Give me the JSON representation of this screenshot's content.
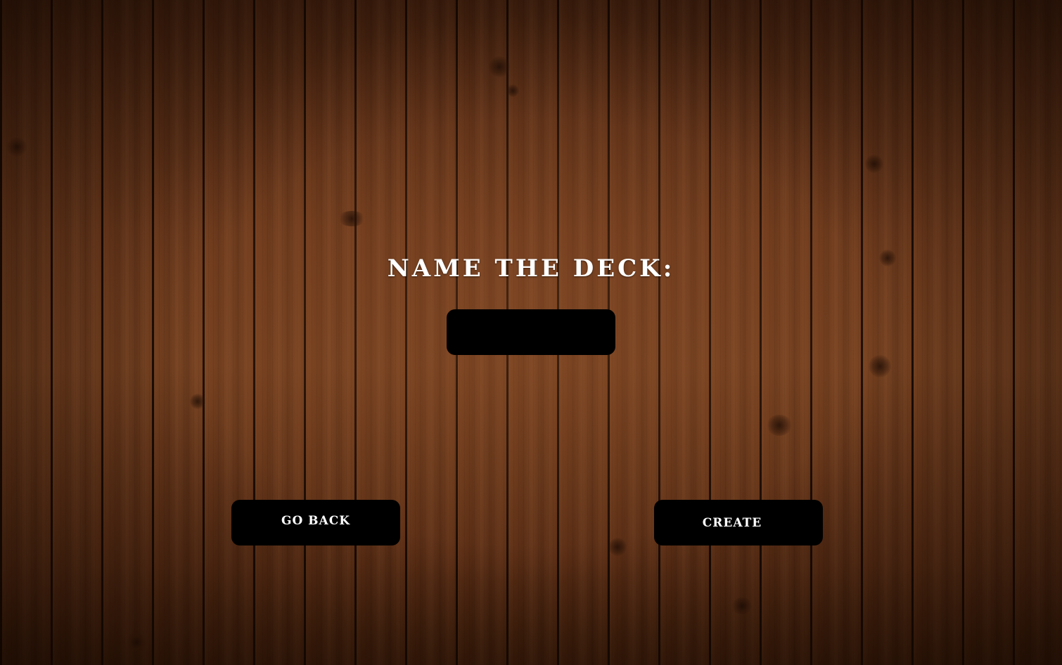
{
  "screen": {
    "title": "Name the deck:"
  },
  "deck_name_input": {
    "value": "",
    "placeholder": ""
  },
  "buttons": {
    "go_back_label": "Go back",
    "create_label": "Create"
  },
  "colors": {
    "background_wood": "#5a2e14",
    "button_fill": "#000000",
    "text": "#ffffff"
  }
}
